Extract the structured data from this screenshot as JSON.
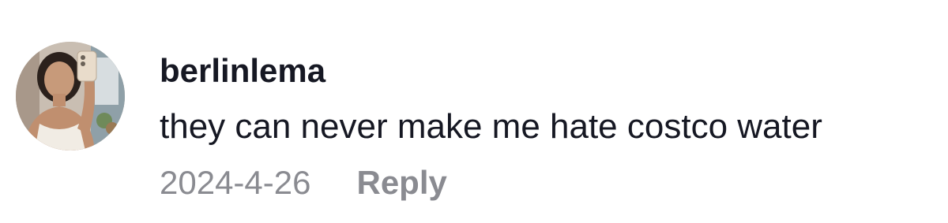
{
  "comment": {
    "username": "berlinlema",
    "text": "they can never make me hate costco water",
    "date": "2024-4-26",
    "reply_label": "Reply",
    "avatar_icon": "user-avatar-photo"
  },
  "colors": {
    "primary_text": "#161823",
    "secondary_text": "#8a8b91",
    "background": "#ffffff"
  }
}
